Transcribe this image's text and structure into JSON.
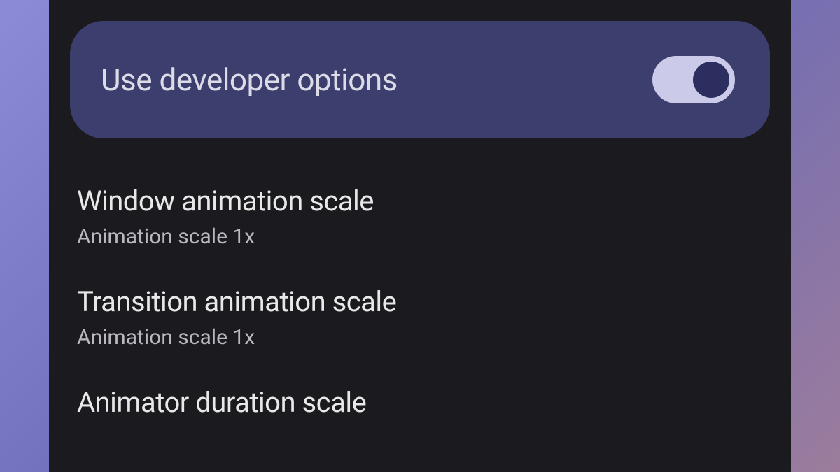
{
  "toggle": {
    "label": "Use developer options",
    "enabled": true
  },
  "settings": [
    {
      "title": "Window animation scale",
      "subtitle": "Animation scale 1x"
    },
    {
      "title": "Transition animation scale",
      "subtitle": "Animation scale 1x"
    },
    {
      "title": "Animator duration scale",
      "subtitle": ""
    }
  ]
}
